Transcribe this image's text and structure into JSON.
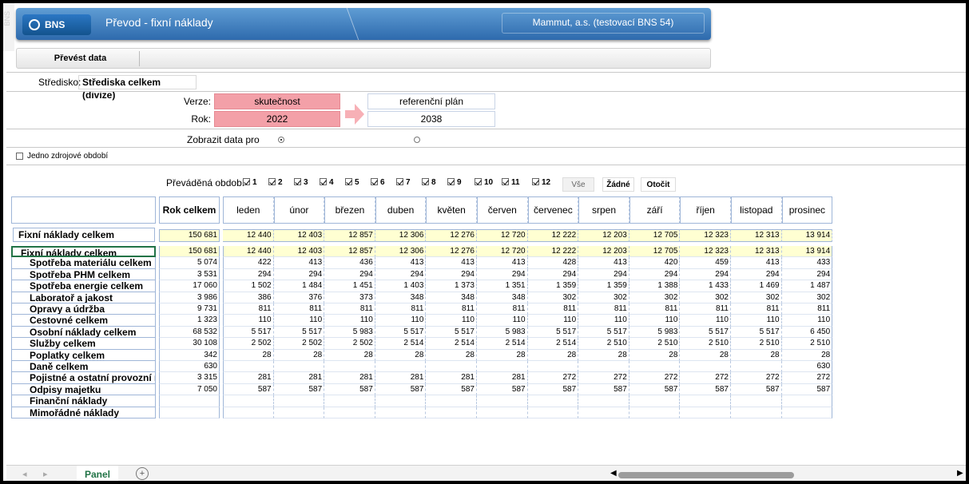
{
  "app": {
    "logo": "BNS",
    "title": "Převod - fixní náklady",
    "company": "Mammut, a.s. (testovací BNS 54)",
    "side_label": "BNS"
  },
  "toolbar": {
    "convert_label": "Převést data"
  },
  "center": {
    "label": "Středisko:",
    "value": "Střediska celkem (divize)"
  },
  "version": {
    "label": "Verze:",
    "source": "skutečnost",
    "target": "referenční plán"
  },
  "year": {
    "label": "Rok:",
    "source": "2022",
    "target": "2038"
  },
  "show_data": {
    "label": "Zobrazit data pro"
  },
  "single_period": {
    "label": "Jedno zdrojové období"
  },
  "periods": {
    "label": "Převáděná období",
    "items": [
      "1",
      "2",
      "3",
      "4",
      "5",
      "6",
      "7",
      "8",
      "9",
      "10",
      "11",
      "12"
    ],
    "all_label": "Vše",
    "none_label": "Žádné",
    "reverse_label": "Otočit"
  },
  "table": {
    "total_header": "Rok celkem",
    "months": [
      "leden",
      "únor",
      "březen",
      "duben",
      "květen",
      "červen",
      "červenec",
      "srpen",
      "září",
      "říjen",
      "listopad",
      "prosinec"
    ],
    "summary": {
      "label": "Fixní náklady celkem",
      "total": "150 681",
      "values": [
        "12 440",
        "12 403",
        "12 857",
        "12 306",
        "12 276",
        "12 720",
        "12 222",
        "12 203",
        "12 705",
        "12 323",
        "12 313",
        "13 914"
      ]
    },
    "rows": [
      {
        "label": "Fixní náklady celkem",
        "total": "150 681",
        "values": [
          "12 440",
          "12 403",
          "12 857",
          "12 306",
          "12 276",
          "12 720",
          "12 222",
          "12 203",
          "12 705",
          "12 323",
          "12 313",
          "13 914"
        ]
      },
      {
        "label": "Spotřeba materiálu celkem",
        "total": "5 074",
        "values": [
          "422",
          "413",
          "436",
          "413",
          "413",
          "413",
          "428",
          "413",
          "420",
          "459",
          "413",
          "433"
        ]
      },
      {
        "label": "Spotřeba PHM celkem",
        "total": "3 531",
        "values": [
          "294",
          "294",
          "294",
          "294",
          "294",
          "294",
          "294",
          "294",
          "294",
          "294",
          "294",
          "294"
        ]
      },
      {
        "label": "Spotřeba energie celkem",
        "total": "17 060",
        "values": [
          "1 502",
          "1 484",
          "1 451",
          "1 403",
          "1 373",
          "1 351",
          "1 359",
          "1 359",
          "1 388",
          "1 433",
          "1 469",
          "1 487"
        ]
      },
      {
        "label": "Laboratoř a jakost",
        "total": "3 986",
        "values": [
          "386",
          "376",
          "373",
          "348",
          "348",
          "348",
          "302",
          "302",
          "302",
          "302",
          "302",
          "302"
        ]
      },
      {
        "label": "Opravy a údržba",
        "total": "9 731",
        "values": [
          "811",
          "811",
          "811",
          "811",
          "811",
          "811",
          "811",
          "811",
          "811",
          "811",
          "811",
          "811"
        ]
      },
      {
        "label": "Cestovné celkem",
        "total": "1 323",
        "values": [
          "110",
          "110",
          "110",
          "110",
          "110",
          "110",
          "110",
          "110",
          "110",
          "110",
          "110",
          "110"
        ]
      },
      {
        "label": "Osobní náklady celkem",
        "total": "68 532",
        "values": [
          "5 517",
          "5 517",
          "5 983",
          "5 517",
          "5 517",
          "5 983",
          "5 517",
          "5 517",
          "5 983",
          "5 517",
          "5 517",
          "6 450"
        ]
      },
      {
        "label": "Služby celkem",
        "total": "30 108",
        "values": [
          "2 502",
          "2 502",
          "2 502",
          "2 514",
          "2 514",
          "2 514",
          "2 514",
          "2 510",
          "2 510",
          "2 510",
          "2 510",
          "2 510"
        ]
      },
      {
        "label": "Poplatky celkem",
        "total": "342",
        "values": [
          "28",
          "28",
          "28",
          "28",
          "28",
          "28",
          "28",
          "28",
          "28",
          "28",
          "28",
          "28"
        ]
      },
      {
        "label": "Daně celkem",
        "total": "630",
        "values": [
          "",
          "",
          "",
          "",
          "",
          "",
          "",
          "",
          "",
          "",
          "",
          "630"
        ]
      },
      {
        "label": "Pojistné a ostatní provozní nák",
        "total": "3 315",
        "values": [
          "281",
          "281",
          "281",
          "281",
          "281",
          "281",
          "272",
          "272",
          "272",
          "272",
          "272",
          "272"
        ]
      },
      {
        "label": "Odpisy majetku",
        "total": "7 050",
        "values": [
          "587",
          "587",
          "587",
          "587",
          "587",
          "587",
          "587",
          "587",
          "587",
          "587",
          "587",
          "587"
        ]
      },
      {
        "label": "Finanční náklady",
        "total": "",
        "values": [
          "",
          "",
          "",
          "",
          "",
          "",
          "",
          "",
          "",
          "",
          "",
          ""
        ]
      },
      {
        "label": "Mimořádné náklady",
        "total": "",
        "values": [
          "",
          "",
          "",
          "",
          "",
          "",
          "",
          "",
          "",
          "",
          "",
          ""
        ]
      }
    ]
  },
  "sheet": {
    "tab": "Panel",
    "add_label": "+"
  }
}
